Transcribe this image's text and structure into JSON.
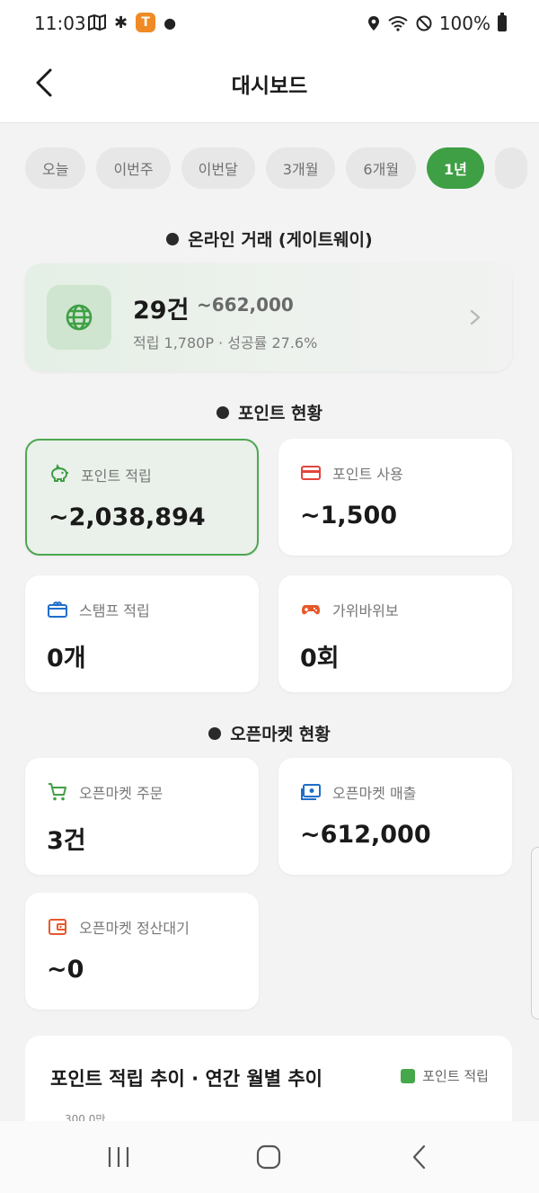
{
  "status": {
    "time": "11:03",
    "battery": "100%",
    "badge": "T"
  },
  "header": {
    "title": "대시보드"
  },
  "tabs": [
    {
      "label": "오늘"
    },
    {
      "label": "이번주"
    },
    {
      "label": "이번달"
    },
    {
      "label": "3개월"
    },
    {
      "label": "6개월"
    },
    {
      "label": "1년"
    }
  ],
  "online": {
    "section": "온라인 거래 (게이트웨이)",
    "count": "29건",
    "amount": "~662,000",
    "sub": "적립 1,780P · 성공률 27.6%"
  },
  "points": {
    "section": "포인트 현황",
    "earn": {
      "label": "포인트 적립",
      "value": "~2,038,894"
    },
    "use": {
      "label": "포인트 사용",
      "value": "~1,500"
    },
    "stamp": {
      "label": "스탬프 적립",
      "value": "0개"
    },
    "game": {
      "label": "가위바위보",
      "value": "0회"
    }
  },
  "market": {
    "section": "오픈마켓 현황",
    "orders": {
      "label": "오픈마켓 주문",
      "value": "3건"
    },
    "sales": {
      "label": "오픈마켓 매출",
      "value": "~612,000"
    },
    "pending": {
      "label": "오픈마켓 정산대기",
      "value": "~0"
    }
  },
  "chart": {
    "title": "포인트 적립 추이 · 연간 월별 추이",
    "legend": "포인트 적립",
    "ytick_top": "300.0만"
  },
  "colors": {
    "accent": "#3f9f45",
    "red": "#e0463d",
    "blue": "#1f6fc9",
    "orange": "#e6592b"
  }
}
